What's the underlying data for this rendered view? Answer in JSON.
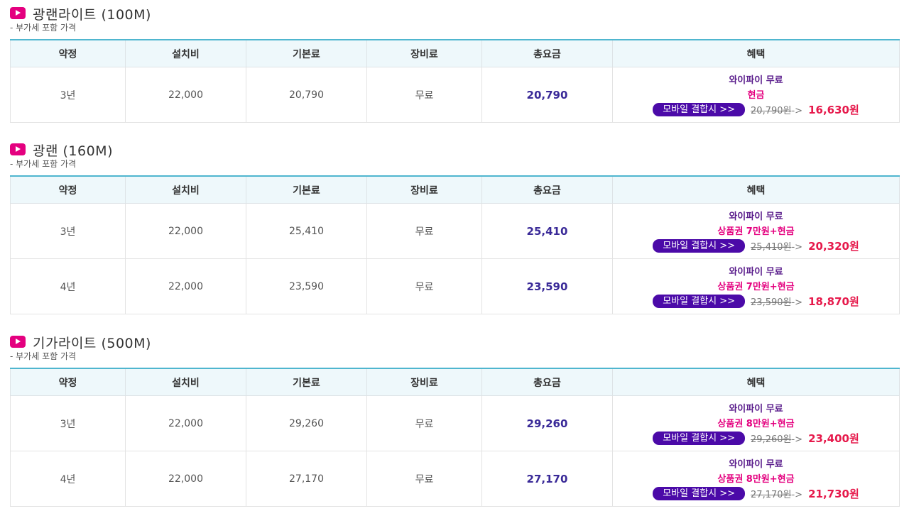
{
  "vat_note": "- 부가세 포함 가격",
  "headers": [
    "약정",
    "설치비",
    "기본료",
    "장비료",
    "총요금",
    "혜택"
  ],
  "sections": [
    {
      "title": "광랜라이트 (100M)",
      "rows": [
        {
          "term": "3년",
          "install": "22,000",
          "base": "20,790",
          "equipment": "무료",
          "total": "20,790",
          "benefit_line1": "와이파이 무료",
          "benefit_line2": "현금",
          "mobile_label": "모바일 결합시 >>",
          "orig_price": "20,790원",
          "arrow": "->",
          "final_price": "16,630원"
        }
      ]
    },
    {
      "title": "광랜 (160M)",
      "rows": [
        {
          "term": "3년",
          "install": "22,000",
          "base": "25,410",
          "equipment": "무료",
          "total": "25,410",
          "benefit_line1": "와이파이 무료",
          "benefit_line2": "상품권 7만원+현금",
          "mobile_label": "모바일 결합시 >>",
          "orig_price": "25,410원",
          "arrow": "->",
          "final_price": "20,320원"
        },
        {
          "term": "4년",
          "install": "22,000",
          "base": "23,590",
          "equipment": "무료",
          "total": "23,590",
          "benefit_line1": "와이파이 무료",
          "benefit_line2": "상품권 7만원+현금",
          "mobile_label": "모바일 결합시 >>",
          "orig_price": "23,590원",
          "arrow": "->",
          "final_price": "18,870원"
        }
      ]
    },
    {
      "title": "기가라이트 (500M)",
      "rows": [
        {
          "term": "3년",
          "install": "22,000",
          "base": "29,260",
          "equipment": "무료",
          "total": "29,260",
          "benefit_line1": "와이파이 무료",
          "benefit_line2": "상품권 8만원+현금",
          "mobile_label": "모바일 결합시 >>",
          "orig_price": "29,260원",
          "arrow": "->",
          "final_price": "23,400원"
        },
        {
          "term": "4년",
          "install": "22,000",
          "base": "27,170",
          "equipment": "무료",
          "total": "27,170",
          "benefit_line1": "와이파이 무료",
          "benefit_line2": "상품권 8만원+현금",
          "mobile_label": "모바일 결합시 >>",
          "orig_price": "27,170원",
          "arrow": "->",
          "final_price": "21,730원"
        }
      ]
    }
  ],
  "colors": {
    "accent_pink": "#e4007f",
    "total_text": "#3a2a98",
    "mobile_button": "#4b0aa8",
    "final_price": "#e6194b",
    "header_bg": "#eef8fb",
    "table_top_border": "#4fb6cf"
  },
  "icons": {
    "section_icon": "play-icon"
  }
}
